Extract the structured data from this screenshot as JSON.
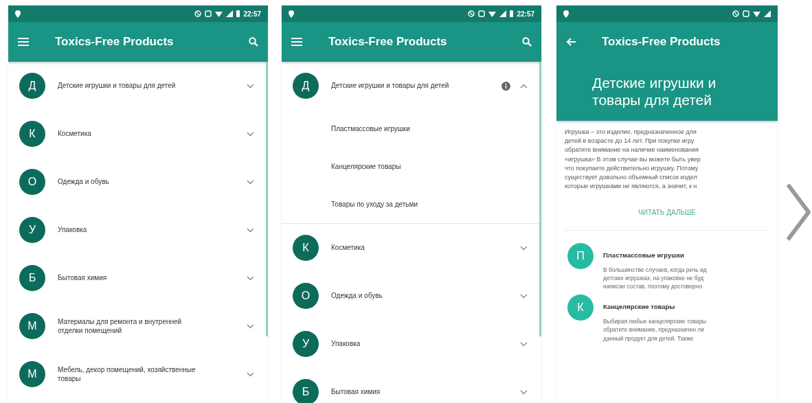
{
  "screens": [
    {
      "kind": "list",
      "status_time": "22:57",
      "nav": {
        "kind": "menu"
      },
      "title": "Toxics-Free Products",
      "search": true,
      "categories": [
        {
          "letter": "Д",
          "name": "Детские игрушки и товары для детей",
          "expanded": false
        },
        {
          "letter": "К",
          "name": "Косметика",
          "expanded": false
        },
        {
          "letter": "О",
          "name": "Одежда и обувь",
          "expanded": false
        },
        {
          "letter": "У",
          "name": "Упаковка",
          "expanded": false
        },
        {
          "letter": "Б",
          "name": "Бытовая химия",
          "expanded": false
        },
        {
          "letter": "М",
          "name": "Материалы для ремонта и внутренней отделки помещений",
          "expanded": false
        },
        {
          "letter": "М",
          "name": "Мебель, декор помещений, хозяйственные товары",
          "expanded": false
        }
      ]
    },
    {
      "kind": "list",
      "status_time": "22:57",
      "nav": {
        "kind": "menu"
      },
      "title": "Toxics-Free Products",
      "search": true,
      "categories": [
        {
          "letter": "Д",
          "name": "Детские игрушки и товары для детей",
          "expanded": true,
          "subcategories": [
            "Пластмассовые игрушки",
            "Канцелярские товары",
            "Товары по уходу за детьми"
          ]
        },
        {
          "letter": "К",
          "name": "Косметика",
          "expanded": false
        },
        {
          "letter": "О",
          "name": "Одежда и обувь",
          "expanded": false
        },
        {
          "letter": "У",
          "name": "Упаковка",
          "expanded": false
        },
        {
          "letter": "Б",
          "name": "Бытовая химия",
          "expanded": false
        }
      ]
    },
    {
      "kind": "detail",
      "nav": {
        "kind": "back"
      },
      "title": "Toxics-Free Products",
      "header_title": "Детские игрушки и товары для детей",
      "description_lines": [
        "Игрушка – это изделие, предназначенное для",
        "детей в возрасте до 14 лет. При покупке игру",
        "обратите внимание на наличие наименования",
        "«игрушка» В этом случае вы можете быть увер",
        "что покупаете действительно игрушку. Потому",
        "существует довольно объемный список издел",
        "которые игрушками не являются, а значит, к н"
      ],
      "read_more": "ЧИТАТЬ ДАЛЬШЕ",
      "sections": [
        {
          "letter": "П",
          "title": "Пластмассовые игрушки",
          "text_lines": [
            "В большинстве случаев, когда речь ид",
            "детских игрушках, на упаковке не буд",
            "написан состав, поэтому достоверно"
          ]
        },
        {
          "letter": "К",
          "title": "Канцелярские товары",
          "text_lines": [
            "Выбирая любые канцелярские товары",
            "обратите внимание, предназначен ли",
            "данный продукт для детей. Также"
          ]
        }
      ]
    }
  ]
}
